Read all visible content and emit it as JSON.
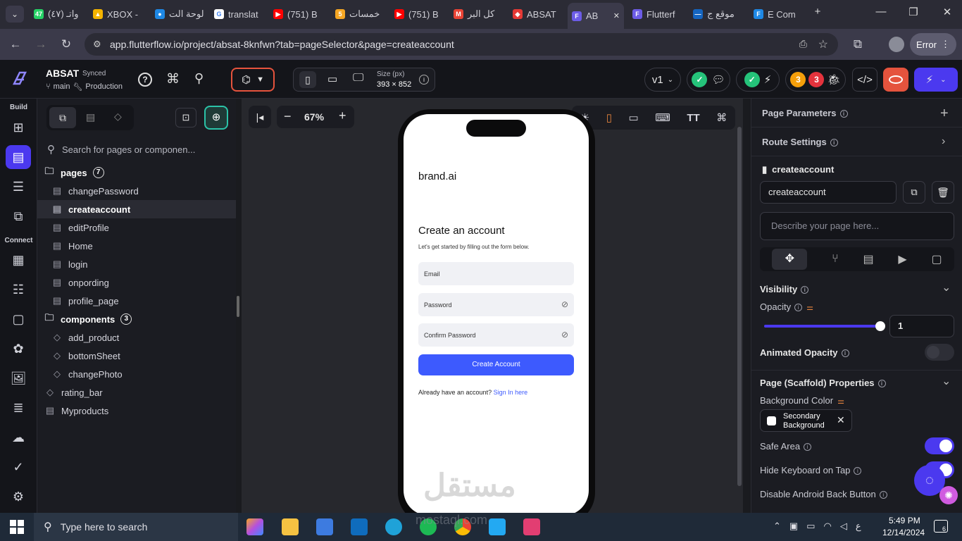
{
  "tabs": [
    {
      "label": "(٤٧) واتـ",
      "color": "#25d366",
      "badge": "47"
    },
    {
      "label": "XBOX -",
      "color": "#f4b400",
      "badge": "▲"
    },
    {
      "label": "لوحة الت",
      "color": "#1e88e5",
      "badge": "●"
    },
    {
      "label": "translat",
      "color": "#ffffff",
      "badge": "G"
    },
    {
      "label": "(751) B",
      "color": "#ff0000",
      "badge": "▶"
    },
    {
      "label": "خمسات",
      "color": "#f5a623",
      "badge": "5"
    },
    {
      "label": "(751) B",
      "color": "#ff0000",
      "badge": "▶"
    },
    {
      "label": "كل البر",
      "color": "#ea4335",
      "badge": "M"
    },
    {
      "label": "ABSAT",
      "color": "#e53935",
      "badge": "◆"
    },
    {
      "label": "AB",
      "color": "#6c5ce7",
      "badge": "F"
    },
    {
      "label": "Flutterf",
      "color": "#6c5ce7",
      "badge": "F"
    },
    {
      "label": "موقع ج",
      "color": "#1565c0",
      "badge": "—"
    },
    {
      "label": "E Com",
      "color": "#1e88e5",
      "badge": "F"
    }
  ],
  "browser": {
    "url": "app.flutterflow.io/project/absat-8knfwn?tab=pageSelector&page=createaccount",
    "error_label": "Error"
  },
  "header": {
    "project": "ABSAT",
    "sync_status": "Synced",
    "branch": "main",
    "environment": "Production",
    "size_label": "Size (px)",
    "size_value": "393 × 852",
    "version": "v1",
    "badge_warnings": "3",
    "badge_errors": "3"
  },
  "rail": {
    "build_label": "Build",
    "connect_label": "Connect"
  },
  "tree": {
    "search_placeholder": "Search for pages or componen...",
    "pages_label": "pages",
    "pages_count": "7",
    "pages": [
      "changePassword",
      "createaccount",
      "editProfile",
      "Home",
      "login",
      "onpording",
      "profile_page"
    ],
    "components_label": "components",
    "components_count": "3",
    "components": [
      "add_product",
      "bottomSheet",
      "changePhoto"
    ],
    "extra": [
      "rating_bar",
      "Myproducts"
    ]
  },
  "canvas": {
    "zoom": "67%"
  },
  "phone": {
    "brand": "brand.ai",
    "title": "Create an account",
    "subtitle": "Let's get started by filling out the form below.",
    "email_label": "Email",
    "password_label": "Password",
    "confirm_label": "Confirm Password",
    "button_label": "Create Account",
    "signin_prefix": "Already have an account?",
    "signin_link": "Sign In here"
  },
  "right": {
    "page_params": "Page Parameters",
    "route_settings": "Route Settings",
    "page_name_header": "createaccount",
    "page_name_value": "createaccount",
    "describe_placeholder": "Describe your page here...",
    "visibility": "Visibility",
    "opacity": "Opacity",
    "opacity_value": "1",
    "opacity_fraction": 1,
    "animated_opacity": "Animated Opacity",
    "scaffold": "Page (Scaffold) Properties",
    "bg_color": "Background Color",
    "bg_color_value": "Secondary Background",
    "safe_area": "Safe Area",
    "hide_keyboard": "Hide Keyboard on Tap",
    "disable_back": "Disable Android Back Button"
  },
  "taskbar": {
    "search_placeholder": "Type here to search",
    "time": "5:49 PM",
    "date": "12/14/2024",
    "lang": "ع",
    "notifications": "6"
  },
  "watermark": {
    "text": "مستقل",
    "sub": "mostaql.com"
  },
  "colors": {
    "accent": "#4b39ef",
    "button": "#3d5afe",
    "link": "#3d5afe"
  }
}
